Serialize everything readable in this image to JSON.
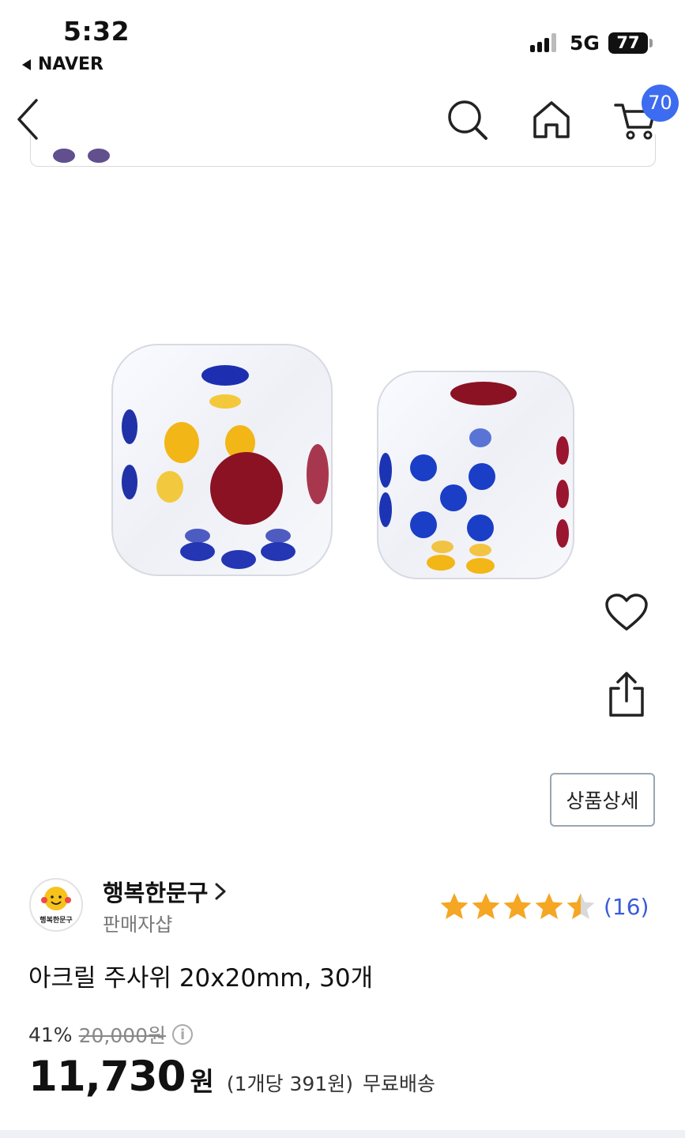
{
  "status_bar": {
    "time": "5:32",
    "back_app": "NAVER",
    "network": "5G",
    "battery": "77"
  },
  "nav": {
    "cart_count": "70",
    "icons": [
      "back-chevron-icon",
      "search-icon",
      "home-icon",
      "cart-icon"
    ]
  },
  "side_actions": [
    "heart-icon",
    "share-icon"
  ],
  "detail_button": "상품상세",
  "seller": {
    "logo_text": "행복한문구",
    "name": "행복한문구",
    "type": "판매자샵",
    "rating": 4.5,
    "review_count": "(16)"
  },
  "product": {
    "title": "아크릴 주사위 20x20mm, 30개",
    "discount": "41%",
    "original_price": "20,000원",
    "price": "11,730",
    "currency": "원",
    "unit_price": "(1개당 391원)",
    "shipping": "무료배송"
  },
  "colors": {
    "accent": "#3d6cf0",
    "star": "#f5a623",
    "review_link": "#3a5bd9"
  }
}
